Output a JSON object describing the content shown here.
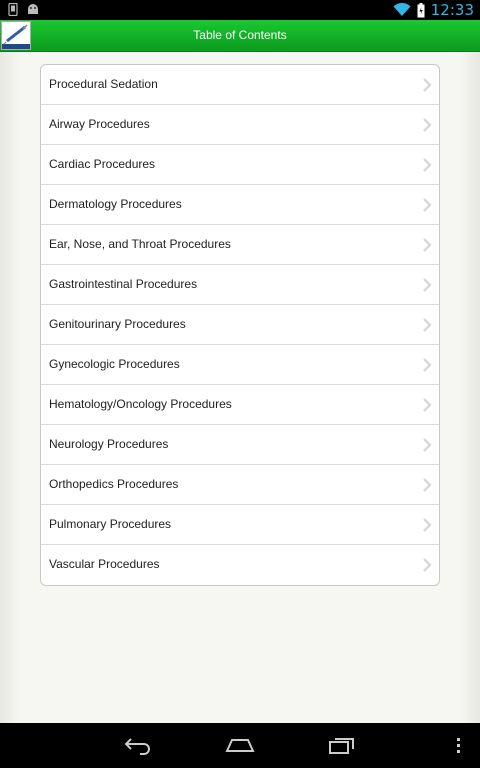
{
  "status": {
    "time": "12:33"
  },
  "header": {
    "title": "Table of Contents"
  },
  "toc": {
    "items": [
      {
        "label": "Procedural Sedation"
      },
      {
        "label": "Airway Procedures"
      },
      {
        "label": "Cardiac Procedures"
      },
      {
        "label": "Dermatology Procedures"
      },
      {
        "label": "Ear, Nose, and Throat Procedures"
      },
      {
        "label": "Gastrointestinal Procedures"
      },
      {
        "label": "Genitourinary Procedures"
      },
      {
        "label": "Gynecologic Procedures"
      },
      {
        "label": "Hematology/Oncology Procedures"
      },
      {
        "label": "Neurology Procedures"
      },
      {
        "label": "Orthopedics Procedures"
      },
      {
        "label": "Pulmonary Procedures"
      },
      {
        "label": "Vascular Procedures"
      }
    ]
  },
  "colors": {
    "header_green": "#14b428",
    "status_accent": "#33b5e5"
  },
  "icons": {
    "status_left": [
      "tablet-icon",
      "android-icon"
    ],
    "status_right": [
      "wifi-icon",
      "battery-icon"
    ],
    "nav": [
      "back-icon",
      "home-icon",
      "recent-apps-icon",
      "overflow-menu-icon"
    ]
  }
}
